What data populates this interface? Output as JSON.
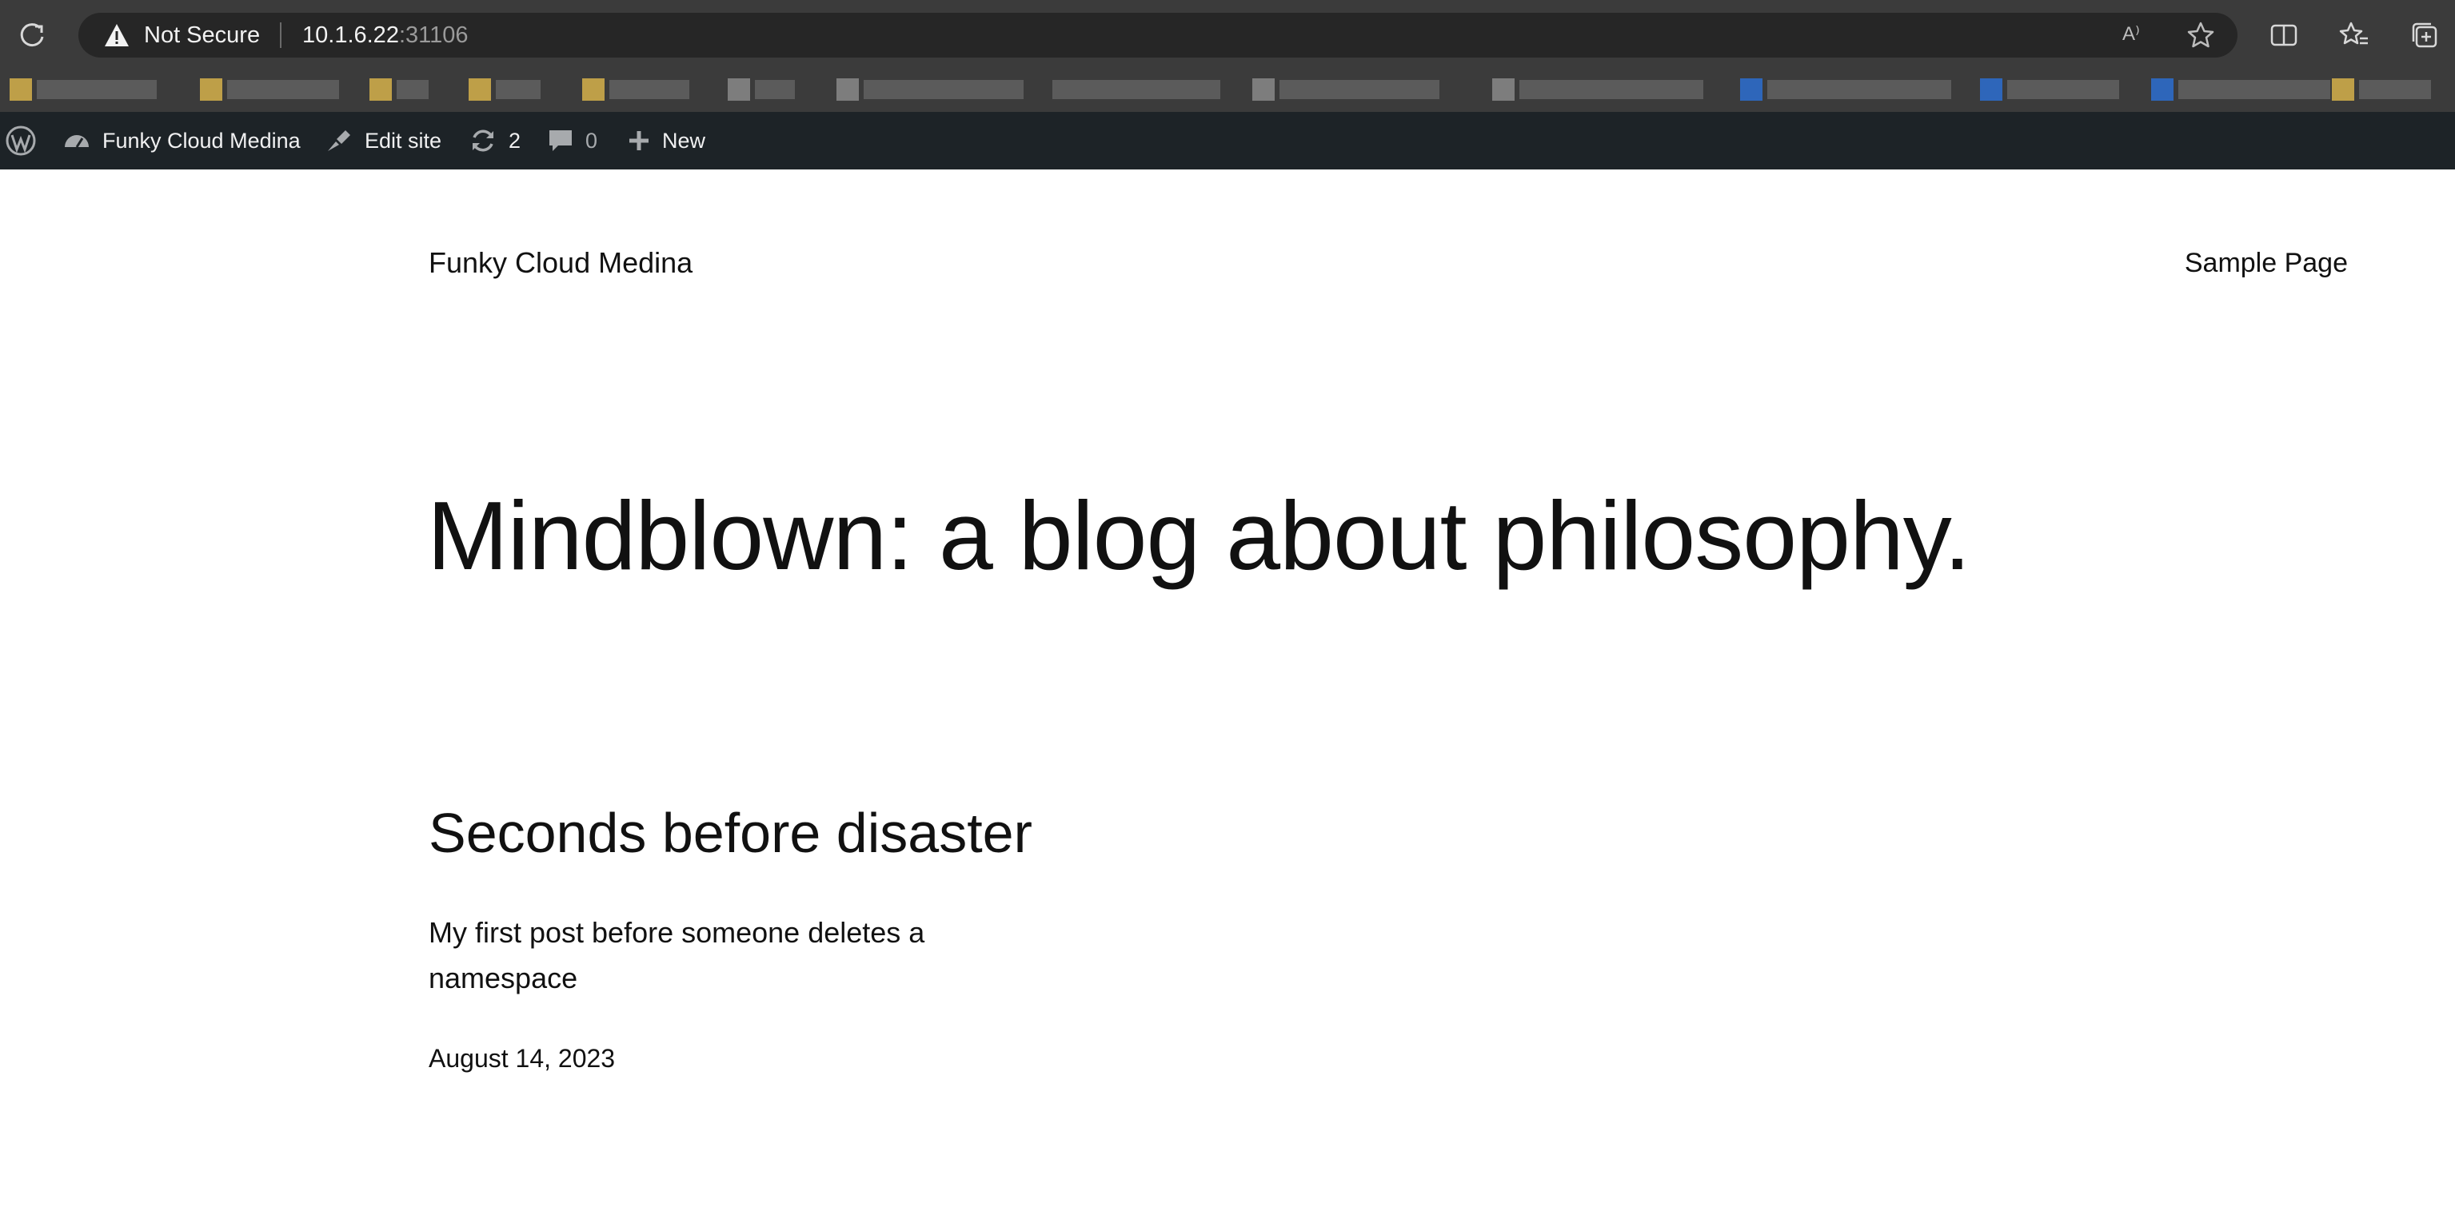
{
  "browser": {
    "security_label": "Not Secure",
    "url_host": "10.1.6.22",
    "url_port": ":31106",
    "read_aloud_label": "A⁾"
  },
  "wp_admin_bar": {
    "site_name": "Funky Cloud Medina",
    "edit_site_label": "Edit site",
    "updates_count": "2",
    "comments_count": "0",
    "new_label": "New"
  },
  "site": {
    "title": "Funky Cloud Medina",
    "nav": {
      "sample_page": "Sample Page"
    },
    "hero_heading": "Mindblown: a blog about philosophy."
  },
  "post": {
    "title": "Seconds before disaster",
    "excerpt": "My first post before someone deletes a namespace",
    "date": "August 14, 2023"
  },
  "colors": {
    "browser_chrome": "#3b3b3b",
    "address_bar": "#262626",
    "wp_admin_bar": "#1d2327",
    "page_background": "#ffffff",
    "text": "#111111"
  },
  "icons": {
    "reload": "reload-icon",
    "warning": "warning-icon",
    "favorite": "star-icon",
    "split_screen": "split-screen-icon",
    "favorites": "favorites-icon",
    "collections": "collections-icon",
    "wordpress": "wordpress-logo-icon",
    "dashboard": "dashboard-icon",
    "edit": "brush-icon",
    "updates": "updates-icon",
    "comments": "comment-icon",
    "new": "plus-icon"
  }
}
